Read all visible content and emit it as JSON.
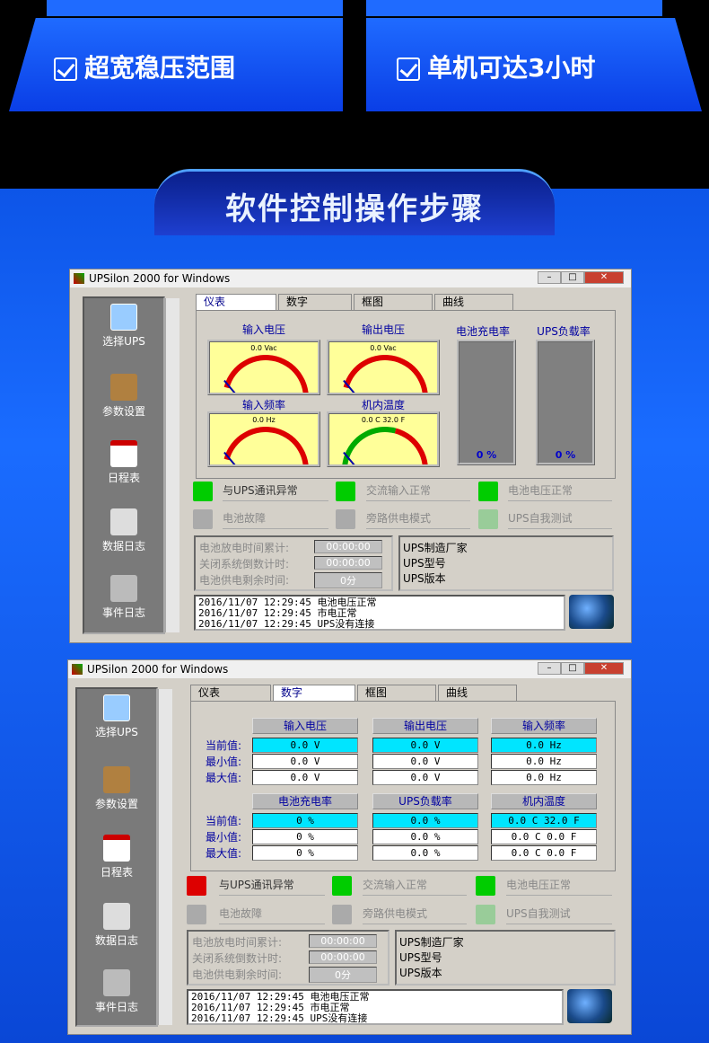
{
  "banner": {
    "left_label": "超宽稳压范围",
    "right_label": "单机可达3小时",
    "section_title": "软件控制操作步骤"
  },
  "window1": {
    "title": "UPSilon 2000 for Windows",
    "tabs": [
      "仪表",
      "数字",
      "框图",
      "曲线"
    ],
    "sidebar": [
      "选择UPS",
      "参数设置",
      "日程表",
      "数据日志",
      "事件日志"
    ],
    "gauges": {
      "input_voltage": "输入电压",
      "output_voltage": "输出电压",
      "input_freq": "输入频率",
      "temp": "机内温度",
      "battery": "电池充电率",
      "load": "UPS负载率"
    },
    "meter_units": {
      "iv": "0.0 Vac",
      "ov": "0.0 Vac",
      "if": "0.0 Hz",
      "t": "0.0 C    32.0 F"
    },
    "meter_ticks": {
      "v": "10 20 30 40 50 60",
      "f": "10 20 30 40 50 60 70",
      "t": "68 104 140 176"
    },
    "bars": {
      "battery": "0 %",
      "load": "0 %"
    },
    "status": [
      "与UPS通讯异常",
      "交流输入正常",
      "电池电压正常",
      "电池故障",
      "旁路供电模式",
      "UPS自我测试"
    ],
    "timers": {
      "discharge": "电池放电时间累计:",
      "countdown": "关闭系统倒数计时:",
      "remain": "电池供电剩余时间:",
      "discharge_val": "00:00:00",
      "countdown_val": "00:00:00",
      "remain_val": "0分"
    },
    "info": [
      "UPS制造厂家",
      "UPS型号",
      "UPS版本"
    ],
    "log": [
      "2016/11/07 12:29:45  电池电压正常",
      "2016/11/07 12:29:45  市电正常",
      "2016/11/07 12:29:45  UPS没有连接"
    ]
  },
  "window2": {
    "title": "UPSilon 2000 for Windows",
    "tabs": [
      "仪表",
      "数字",
      "框图",
      "曲线"
    ],
    "sidebar": [
      "选择UPS",
      "参数设置",
      "日程表",
      "数据日志",
      "事件日志"
    ],
    "headers1": [
      "输入电压",
      "输出电压",
      "输入频率"
    ],
    "headers2": [
      "电池充电率",
      "UPS负载率",
      "机内温度"
    ],
    "row_labels": [
      "当前值:",
      "最小值:",
      "最大值:"
    ],
    "grid1": [
      [
        "0.0 V",
        "0.0 V",
        "0.0 Hz"
      ],
      [
        "0.0 V",
        "0.0 V",
        "0.0 Hz"
      ],
      [
        "0.0 V",
        "0.0 V",
        "0.0 Hz"
      ]
    ],
    "grid2": [
      [
        "0 %",
        "0.0 %",
        "0.0 C   32.0 F"
      ],
      [
        "0 %",
        "0.0 %",
        "0.0 C    0.0 F"
      ],
      [
        "0 %",
        "0.0 %",
        "0.0 C    0.0 F"
      ]
    ],
    "status": [
      "与UPS通讯异常",
      "交流输入正常",
      "电池电压正常",
      "电池故障",
      "旁路供电模式",
      "UPS自我测试"
    ],
    "timers": {
      "discharge": "电池放电时间累计:",
      "countdown": "关闭系统倒数计时:",
      "remain": "电池供电剩余时间:",
      "discharge_val": "00:00:00",
      "countdown_val": "00:00:00",
      "remain_val": "0分"
    },
    "info": [
      "UPS制造厂家",
      "UPS型号",
      "UPS版本"
    ],
    "log": [
      "2016/11/07 12:29:45  电池电压正常",
      "2016/11/07 12:29:45  市电正常",
      "2016/11/07 12:29:45  UPS没有连接"
    ]
  },
  "colors": {
    "accent": "#1f6bff",
    "cyan": "#00e5ff"
  }
}
